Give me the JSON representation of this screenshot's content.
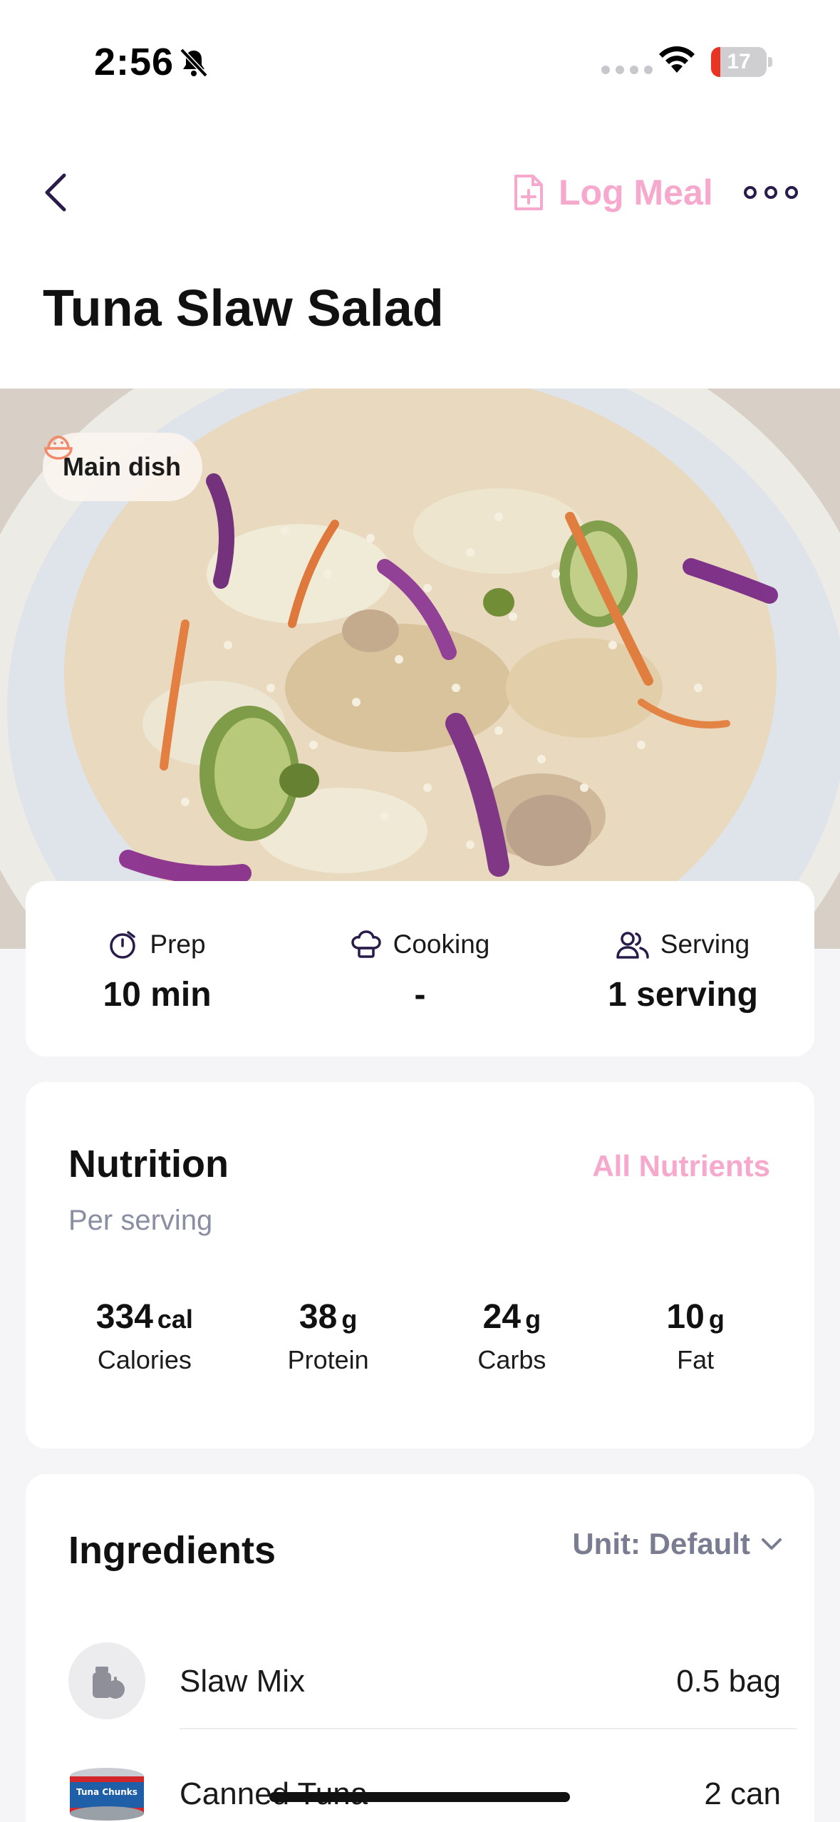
{
  "status_bar": {
    "time": "2:56",
    "battery": "17",
    "battery_level": 0.17
  },
  "nav": {
    "log_meal_label": "Log Meal"
  },
  "recipe": {
    "title": "Tuna Slaw Salad",
    "category": "Main dish",
    "meta": [
      {
        "label": "Prep",
        "value": "10 min",
        "icon": "timer-icon"
      },
      {
        "label": "Cooking",
        "value": "-",
        "icon": "chef-hat-icon"
      },
      {
        "label": "Serving",
        "value": "1 serving",
        "icon": "people-icon"
      }
    ]
  },
  "nutrition": {
    "title": "Nutrition",
    "all_nutrients_label": "All Nutrients",
    "subtitle": "Per serving",
    "macros": [
      {
        "value": "334",
        "unit": "cal",
        "label": "Calories"
      },
      {
        "value": "38",
        "unit": "g",
        "label": "Protein"
      },
      {
        "value": "24",
        "unit": "g",
        "label": "Carbs"
      },
      {
        "value": "10",
        "unit": "g",
        "label": "Fat"
      }
    ]
  },
  "ingredients": {
    "title": "Ingredients",
    "unit_label": "Unit: Default",
    "items": [
      {
        "name": "Slaw Mix",
        "quantity": "0.5 bag",
        "icon": "generic-ingredient-icon"
      },
      {
        "name": "Canned Tuna",
        "quantity": "2 can",
        "icon": "tuna-can-image",
        "image_text": "Tuna Chunks"
      }
    ]
  },
  "colors": {
    "accent_pink": "#f7a8cd",
    "muted": "#8a8ea3",
    "nav_icon": "#2a1c4a"
  }
}
